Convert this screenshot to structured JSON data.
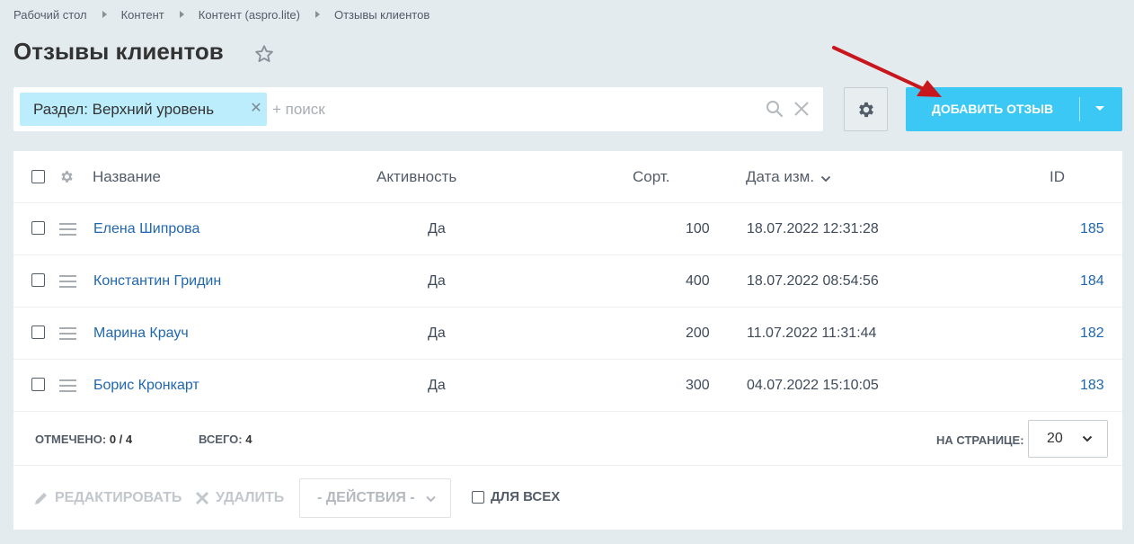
{
  "breadcrumb": [
    "Рабочий стол",
    "Контент",
    "Контент (aspro.lite)",
    "Отзывы клиентов"
  ],
  "page_title": "Отзывы клиентов",
  "filter": {
    "tag_label": "Раздел: Верхний уровень",
    "search_placeholder": "+ поиск"
  },
  "toolbar": {
    "add_label": "ДОБАВИТЬ ОТЗЫВ"
  },
  "grid": {
    "columns": {
      "name": "Название",
      "active": "Активность",
      "sort": "Сорт.",
      "date": "Дата изм.",
      "id": "ID"
    },
    "rows": [
      {
        "name": "Елена Шипрова",
        "active": "Да",
        "sort": "100",
        "date": "18.07.2022 12:31:28",
        "id": "185"
      },
      {
        "name": "Константин Гридин",
        "active": "Да",
        "sort": "400",
        "date": "18.07.2022 08:54:56",
        "id": "184"
      },
      {
        "name": "Марина Крауч",
        "active": "Да",
        "sort": "200",
        "date": "11.07.2022 11:31:44",
        "id": "182"
      },
      {
        "name": "Борис Кронкарт",
        "active": "Да",
        "sort": "300",
        "date": "04.07.2022 15:10:05",
        "id": "183"
      }
    ]
  },
  "footer": {
    "selected_label": "ОТМЕЧЕНО:",
    "selected_value": "0 / 4",
    "total_label": "ВСЕГО:",
    "total_value": "4",
    "per_page_label": "НА СТРАНИЦЕ:",
    "per_page_value": "20",
    "edit_label": "РЕДАКТИРОВАТЬ",
    "delete_label": "УДАЛИТЬ",
    "actions_label": "- ДЕЙСТВИЯ -",
    "for_all_label": "ДЛЯ ВСЕХ"
  },
  "colors": {
    "accent": "#3bc8f5",
    "link": "#2067b0",
    "tag": "#bcedfc",
    "background": "#e3ebee",
    "annotation_arrow": "#c8161d"
  },
  "icons": [
    "star-icon",
    "close-icon",
    "search-icon",
    "clear-icon",
    "gear-icon",
    "chevron-down-icon",
    "hamburger-icon",
    "pencil-icon",
    "cross-icon"
  ]
}
